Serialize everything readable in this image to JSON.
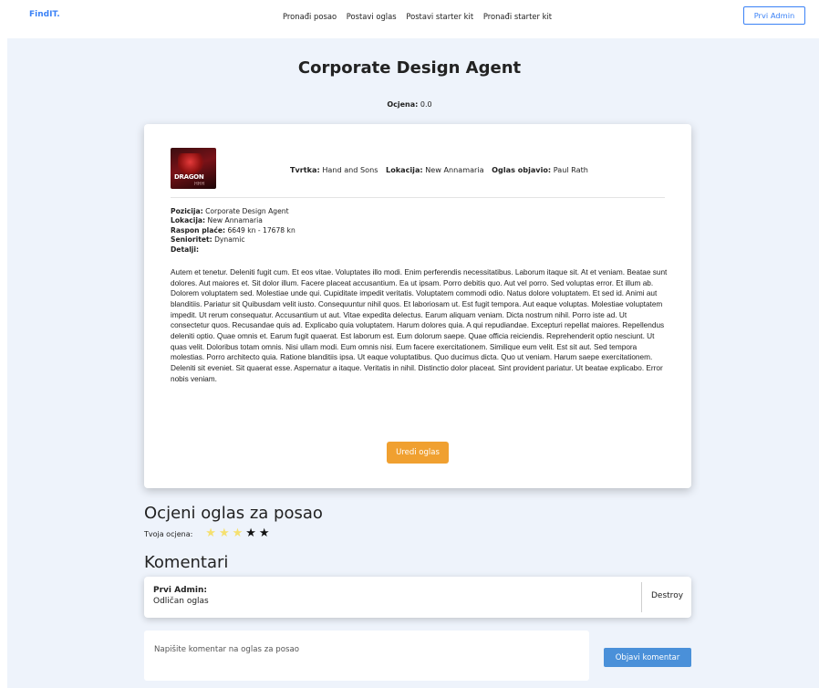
{
  "nav": {
    "brand": "FindIT.",
    "links": [
      "Pronađi posao",
      "Postavi oglas",
      "Postavi starter kit",
      "Pronađi starter kit"
    ],
    "user": "Prvi Admin"
  },
  "job": {
    "title": "Corporate Design Agent",
    "rating_label": "Ocjena:",
    "rating_value": "0.0",
    "logo_text": "DRAGON",
    "logo_sub": "HHH",
    "company_label": "Tvrtka:",
    "company": "Hand and Sons",
    "location_label": "Lokacija:",
    "location": "New Annamaria",
    "posted_by_label": "Oglas objavio:",
    "posted_by": "Paul Rath",
    "position_label": "Pozicija:",
    "position": "Corporate Design Agent",
    "location2_label": "Lokacija:",
    "location2": "New Annamaria",
    "salary_label": "Raspon plaće:",
    "salary": "6649 kn - 17678 kn",
    "seniority_label": "Senioritet:",
    "seniority": "Dynamic",
    "details_label": "Detalji:",
    "description": "Autem et tenetur. Deleniti fugit cum. Et eos vitae. Voluptates illo modi. Enim perferendis necessitatibus. Laborum itaque sit. At et veniam. Beatae sunt dolores. Aut maiores et. Sit dolor illum. Facere placeat accusantium. Ea ut ipsam. Porro debitis quo. Aut vel porro. Sed voluptas error. Et illum ab. Dolorem voluptatem sed. Molestiae unde qui. Cupiditate impedit veritatis. Voluptatem commodi odio. Natus dolore voluptatem. Et sed id. Animi aut blanditiis. Pariatur sit Quibusdam velit iusto. Consequuntur nihil quos. Et laboriosam ut. Est fugit tempora. Aut eaque voluptas. Molestiae voluptatem impedit. Ut rerum consequatur. Accusantium ut aut. Vitae expedita delectus. Earum aliquam veniam. Dicta nostrum nihil. Porro iste ad. Ut consectetur quos. Recusandae quis ad. Explicabo quia voluptatem. Harum dolores quia. A qui repudiandae. Excepturi repellat maiores. Repellendus deleniti optio. Quae omnis et. Earum fugit quaerat. Est laborum est. Eum dolorum saepe. Quae officia reiciendis. Reprehenderit optio nesciunt. Ut quas velit. Doloribus totam omnis. Nisi ullam modi. Eum omnis nisi. Eum facere exercitationem. Similique eum velit. Est sit aut. Sed tempora molestias. Porro architecto quia. Ratione blanditiis ipsa. Ut eaque voluptatibus. Quo ducimus dicta. Quo ut veniam. Harum saepe exercitationem. Deleniti sit eveniet. Sit quaerat esse. Aspernatur a itaque. Veritatis in nihil. Distinctio dolor placeat. Sint provident pariatur. Ut beatae explicabo. Error nobis veniam.",
    "edit_label": "Uredi oglas"
  },
  "rate": {
    "title": "Ocjeni oglas za posao",
    "label": "Tvoja ocjena:",
    "stars_total": 5,
    "stars_selected": 3,
    "star_on_color": "#f5e070",
    "star_off_color": "#111111"
  },
  "comments": {
    "title": "Komentari",
    "items": [
      {
        "author": "Prvi Admin:",
        "text": "Odličan oglas",
        "action": "Destroy"
      }
    ],
    "input_placeholder": "Napišite komentar na oglas za posao",
    "post_label": "Objavi komentar"
  },
  "colors": {
    "accent": "#3b82f6",
    "edit_button": "#f0a030",
    "post_button": "#4a90d9",
    "background": "#eef3fb"
  }
}
